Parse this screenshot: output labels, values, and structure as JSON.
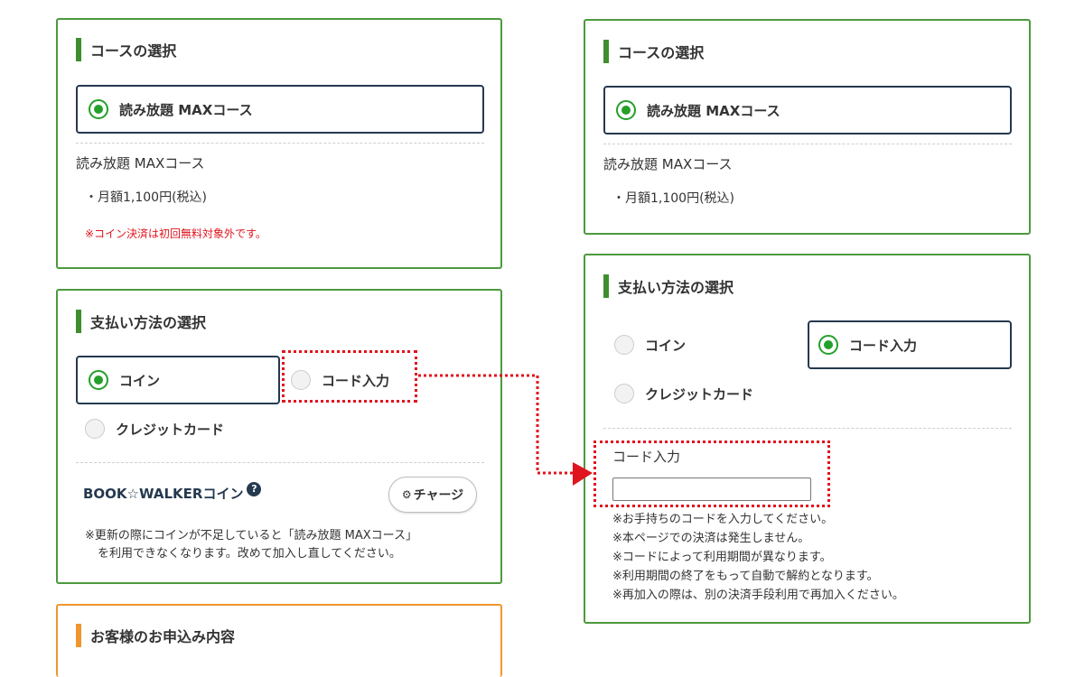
{
  "left": {
    "course": {
      "title": "コースの選択",
      "option_label": "読み放題 MAXコース",
      "plan_name": "読み放題 MAXコース",
      "price": "・月額1,100円(税込)",
      "note": "※コイン決済は初回無料対象外です。"
    },
    "payment": {
      "title": "支払い方法の選択",
      "coin_label": "コイン",
      "code_label": "コード入力",
      "credit_label": "クレジットカード",
      "coin_heading": "BOOK☆WALKERコイン",
      "help_glyph": "?",
      "charge_label": "チャージ",
      "note_line1": "※更新の際にコインが不足していると「読み放題 MAXコース」",
      "note_line2": "を利用できなくなります。改めて加入し直してください。"
    },
    "order": {
      "title": "お客様のお申込み内容"
    }
  },
  "right": {
    "course": {
      "title": "コースの選択",
      "option_label": "読み放題 MAXコース",
      "plan_name": "読み放題 MAXコース",
      "price": "・月額1,100円(税込)"
    },
    "payment": {
      "title": "支払い方法の選択",
      "coin_label": "コイン",
      "code_label": "コード入力",
      "credit_label": "クレジットカード",
      "code_field_label": "コード入力",
      "code_value": "",
      "notes": [
        "※お手持ちのコードを入力してください。",
        "※本ページでの決済は発生しません。",
        "※コードによって利用期間が異なります。",
        "※利用期間の終了をもって自動で解約となります。",
        "※再加入の際は、別の決済手段利用で再加入ください。"
      ]
    }
  },
  "colors": {
    "card_border": "#4d9a3e",
    "section_bar": "#3e8e2f",
    "order_border": "#f0962e",
    "radio_selected": "#24a02a",
    "selected_box": "#25394f",
    "annotation": "#e0141e"
  },
  "icons": {
    "help": "question-circle-icon",
    "charge": "gear-icon",
    "arrow": "arrow-right-icon"
  }
}
